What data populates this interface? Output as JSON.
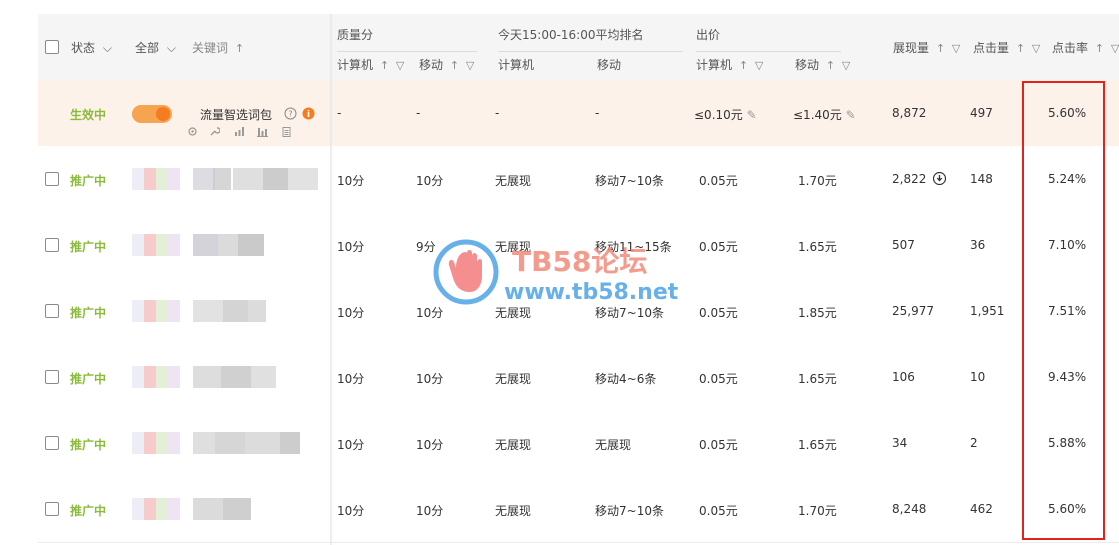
{
  "header": {
    "status_label": "状态",
    "all_label": "全部",
    "keyword_label": "关键词",
    "quality_group": "质量分",
    "ranking_group": "今天15:00-16:00平均排名",
    "bid_group": "出价",
    "pc_label": "计算机",
    "mobile_label": "移动",
    "impressions_label": "展现量",
    "clicks_label": "点击量",
    "ctr_label": "点击率"
  },
  "first_row": {
    "status": "生效中",
    "keyword": "流量智选词包",
    "quality_pc": "-",
    "quality_mobile": "-",
    "rank_pc": "-",
    "rank_mobile": "-",
    "bid_pc": "≤0.10元",
    "bid_mobile": "≤1.40元",
    "impressions": "8,872",
    "clicks": "497",
    "ctr": "5.60%"
  },
  "rows": [
    {
      "status": "推广中",
      "quality_pc": "10分",
      "quality_mobile": "10分",
      "rank_pc": "无展现",
      "rank_mobile": "移动7~10条",
      "bid_pc": "0.05元",
      "bid_mobile": "1.70元",
      "impressions": "2,822",
      "clicks": "148",
      "ctr": "5.24%"
    },
    {
      "status": "推广中",
      "quality_pc": "10分",
      "quality_mobile": "9分",
      "rank_pc": "无展现",
      "rank_mobile": "移动11~15条",
      "bid_pc": "0.05元",
      "bid_mobile": "1.65元",
      "impressions": "507",
      "clicks": "36",
      "ctr": "7.10%"
    },
    {
      "status": "推广中",
      "quality_pc": "10分",
      "quality_mobile": "10分",
      "rank_pc": "无展现",
      "rank_mobile": "移动7~10条",
      "bid_pc": "0.05元",
      "bid_mobile": "1.85元",
      "impressions": "25,977",
      "clicks": "1,951",
      "ctr": "7.51%"
    },
    {
      "status": "推广中",
      "quality_pc": "10分",
      "quality_mobile": "10分",
      "rank_pc": "无展现",
      "rank_mobile": "移动4~6条",
      "bid_pc": "0.05元",
      "bid_mobile": "1.65元",
      "impressions": "106",
      "clicks": "10",
      "ctr": "9.43%"
    },
    {
      "status": "推广中",
      "quality_pc": "10分",
      "quality_mobile": "10分",
      "rank_pc": "无展现",
      "rank_mobile": "无展现",
      "bid_pc": "0.05元",
      "bid_mobile": "1.65元",
      "impressions": "34",
      "clicks": "2",
      "ctr": "5.88%"
    },
    {
      "status": "推广中",
      "quality_pc": "10分",
      "quality_mobile": "10分",
      "rank_pc": "无展现",
      "rank_mobile": "移动7~10条",
      "bid_pc": "0.05元",
      "bid_mobile": "1.70元",
      "impressions": "8,248",
      "clicks": "462",
      "ctr": "5.60%"
    }
  ],
  "watermark": {
    "title": "TB58论坛",
    "url": "www.tb58.net"
  },
  "colors": {
    "status_green": "#8bbb3a",
    "toggle_orange": "#f6a44f",
    "highlight_red": "#e0241c",
    "first_row_bg": "#fcf2ea"
  }
}
